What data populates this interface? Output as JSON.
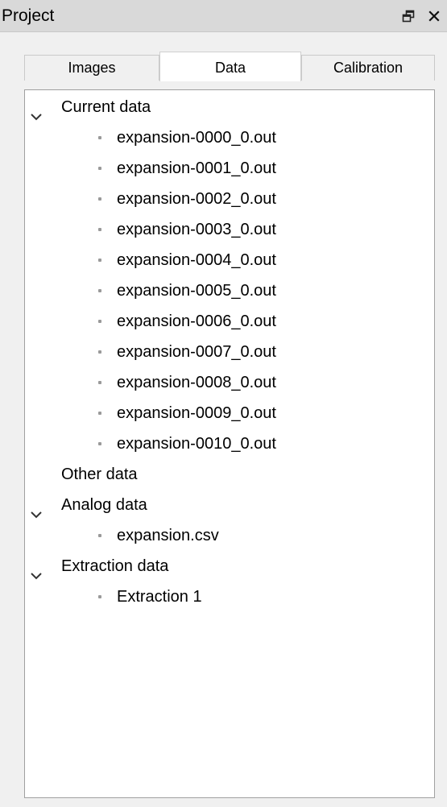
{
  "panel": {
    "title": "Project",
    "float_icon": "float-window-icon",
    "close_icon": "close-icon"
  },
  "tabs": [
    {
      "label": "Images",
      "active": false
    },
    {
      "label": "Data",
      "active": true
    },
    {
      "label": "Calibration",
      "active": false
    }
  ],
  "tree": {
    "current_data": {
      "label": "Current data",
      "expanded": true,
      "items": [
        "expansion-0000_0.out",
        "expansion-0001_0.out",
        "expansion-0002_0.out",
        "expansion-0003_0.out",
        "expansion-0004_0.out",
        "expansion-0005_0.out",
        "expansion-0006_0.out",
        "expansion-0007_0.out",
        "expansion-0008_0.out",
        "expansion-0009_0.out",
        "expansion-0010_0.out"
      ]
    },
    "other_data": {
      "label": "Other data",
      "expanded": false
    },
    "analog_data": {
      "label": "Analog data",
      "expanded": true,
      "items": [
        "expansion.csv"
      ]
    },
    "extraction_data": {
      "label": "Extraction data",
      "expanded": true,
      "items": [
        "Extraction 1"
      ]
    }
  }
}
